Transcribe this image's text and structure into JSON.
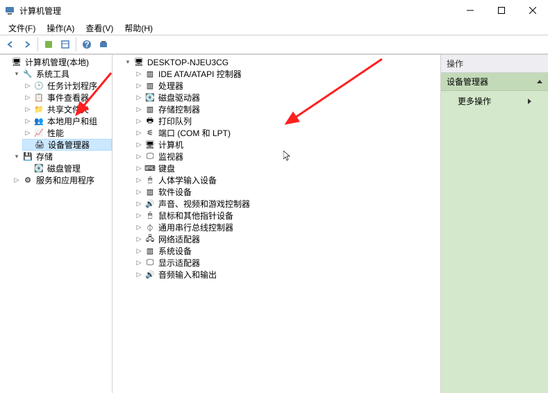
{
  "title": "计算机管理",
  "menu": {
    "file": "文件(F)",
    "action": "操作(A)",
    "view": "查看(V)",
    "help": "帮助(H)"
  },
  "leftTree": {
    "root": "计算机管理(本地)",
    "systemTools": "系统工具",
    "taskScheduler": "任务计划程序",
    "eventViewer": "事件查看器",
    "sharedFolders": "共享文件夹",
    "localUsers": "本地用户和组",
    "performance": "性能",
    "deviceManager": "设备管理器",
    "storage": "存储",
    "diskManagement": "磁盘管理",
    "services": "服务和应用程序"
  },
  "midTree": {
    "root": "DESKTOP-NJEU3CG",
    "items": [
      "IDE ATA/ATAPI 控制器",
      "处理器",
      "磁盘驱动器",
      "存储控制器",
      "打印队列",
      "端口 (COM 和 LPT)",
      "计算机",
      "监视器",
      "键盘",
      "人体学输入设备",
      "软件设备",
      "声音、视频和游戏控制器",
      "鼠标和其他指针设备",
      "通用串行总线控制器",
      "网络适配器",
      "系统设备",
      "显示适配器",
      "音频输入和输出"
    ]
  },
  "rightPane": {
    "header": "操作",
    "section": "设备管理器",
    "moreActions": "更多操作"
  },
  "icons": {
    "computer": "🖥",
    "tools": "🔧",
    "clock": "🕑",
    "events": "📋",
    "folder": "📁",
    "users": "👥",
    "perf": "📈",
    "device": "🖨",
    "storage": "💾",
    "disk": "💽",
    "gear": "⚙",
    "chip": "▥",
    "monitor": "🖵",
    "keyboard": "⌨",
    "mouse": "🖱",
    "usb": "⏀",
    "network": "🖧",
    "audio": "🔊",
    "port": "⚟",
    "printer": "🖶"
  }
}
